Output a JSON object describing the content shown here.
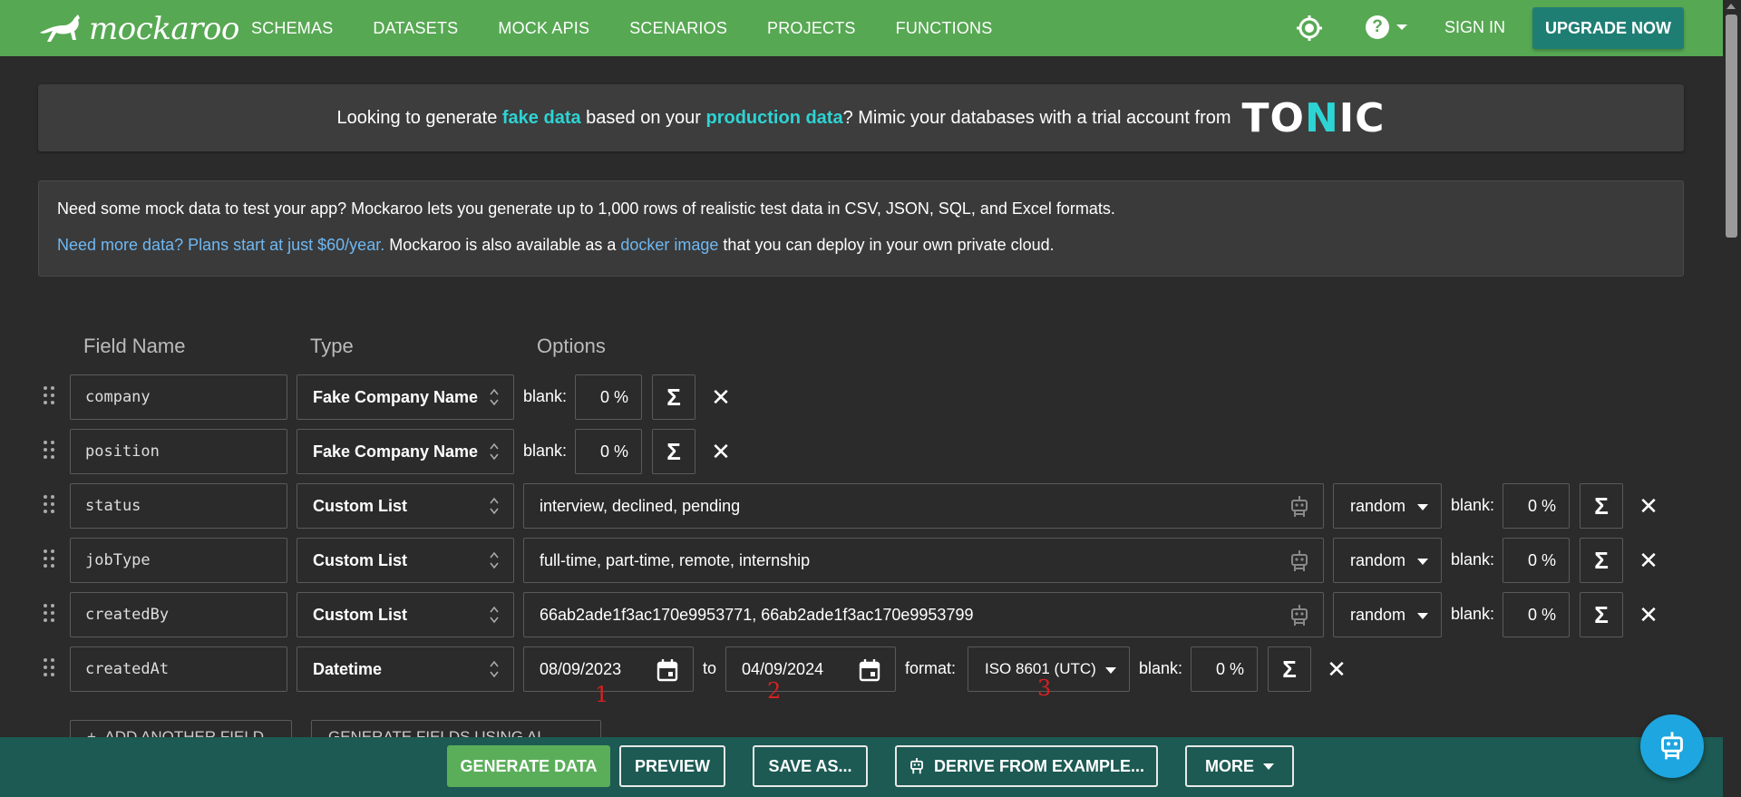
{
  "nav": {
    "logo": "mockaroo",
    "links": [
      "SCHEMAS",
      "DATASETS",
      "MOCK APIS",
      "SCENARIOS",
      "PROJECTS",
      "FUNCTIONS"
    ],
    "sign_in": "SIGN IN",
    "upgrade": "UPGRADE NOW"
  },
  "banner": {
    "t1": "Looking to generate ",
    "h1": "fake data",
    "t2": " based on your ",
    "h2": "production data",
    "t3": "? Mimic your databases with a trial account from",
    "brand_a": "TO",
    "brand_b": "N",
    "brand_c": "IC"
  },
  "info": {
    "line1": "Need some mock data to test your app? Mockaroo lets you generate up to 1,000 rows of realistic test data in CSV, JSON, SQL, and Excel formats.",
    "link1": "Need more data? Plans start at just $60/year.",
    "t2": " Mockaroo is also available as a ",
    "link2": "docker image",
    "t3": " that you can deploy in your own private cloud."
  },
  "headers": {
    "field_name": "Field Name",
    "type": "Type",
    "options": "Options"
  },
  "labels": {
    "blank": "blank:",
    "to": "to",
    "format": "format:",
    "sigma": "Σ",
    "close": "✕"
  },
  "rows": [
    {
      "name": "company",
      "type": "Fake Company Name",
      "blank": "0 %"
    },
    {
      "name": "position",
      "type": "Fake Company Name",
      "blank": "0 %"
    },
    {
      "name": "status",
      "type": "Custom List",
      "values": "interview, declined, pending",
      "order": "random",
      "blank": "0 %"
    },
    {
      "name": "jobType",
      "type": "Custom List",
      "values": "full-time, part-time, remote, internship",
      "order": "random",
      "blank": "0 %"
    },
    {
      "name": "createdBy",
      "type": "Custom List",
      "values": "66ab2ade1f3ac170e9953771, 66ab2ade1f3ac170e9953799",
      "order": "random",
      "blank": "0 %"
    },
    {
      "name": "createdAt",
      "type": "Datetime",
      "from": "08/09/2023",
      "to": "04/09/2024",
      "format": "ISO 8601 (UTC)",
      "blank": "0 %"
    }
  ],
  "annotations": [
    "1",
    "2",
    "3"
  ],
  "bottom": {
    "add_field": "ADD ANOTHER FIELD",
    "gen_ai": "GENERATE FIELDS USING AI..."
  },
  "footer": {
    "generate": "GENERATE DATA",
    "preview": "PREVIEW",
    "save_as": "SAVE AS...",
    "derive": "DERIVE FROM EXAMPLE...",
    "more": "MORE"
  },
  "colors": {
    "nav": "#57a853",
    "accent": "#2ed3d4",
    "footer": "#1c5a53",
    "fab": "#1ea6e0"
  }
}
